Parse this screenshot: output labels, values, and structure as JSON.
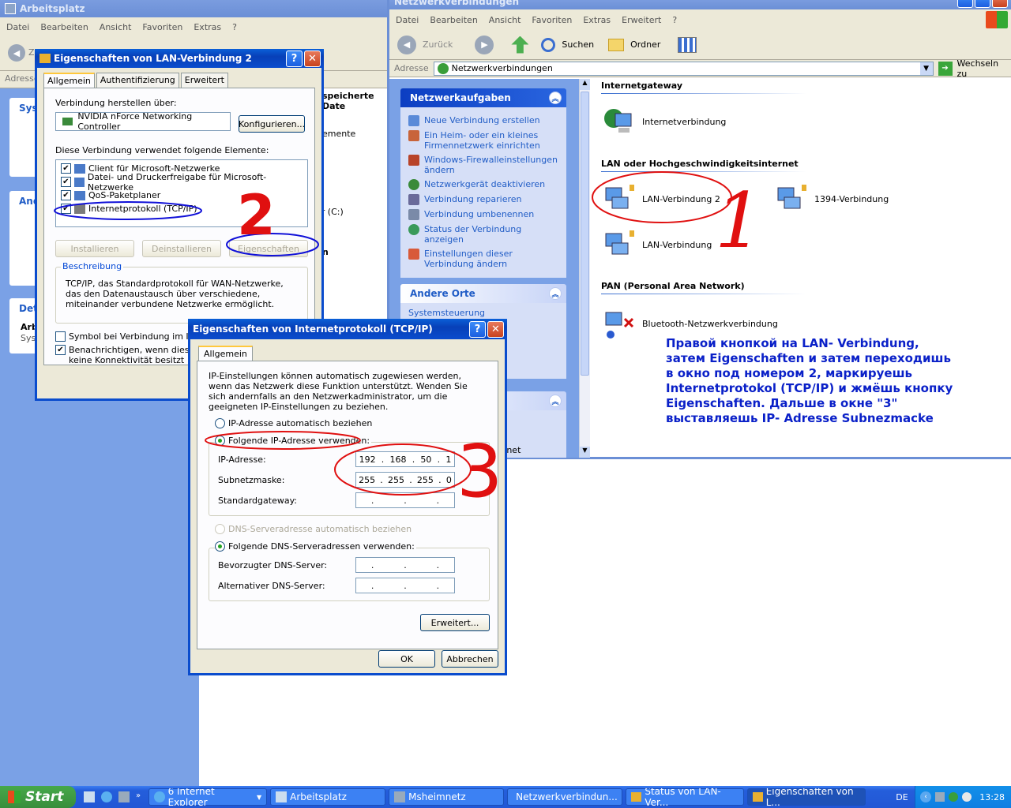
{
  "arbeitsplatz": {
    "title": "Arbeitsplatz",
    "menu": [
      "Datei",
      "Bearbeiten",
      "Ansicht",
      "Favoriten",
      "Extras",
      "?"
    ],
    "address_label": "Adresse",
    "back_label": "Z",
    "side_labels": [
      "Sys",
      "And",
      "Det",
      "Arb",
      "Sys"
    ],
    "frag_1": "speicherte Date",
    "frag_2": "emente",
    "frag_3": "er (C:)",
    "frag_4": "n"
  },
  "netz": {
    "title": "Netzwerkverbindungen",
    "menu": [
      "Datei",
      "Bearbeiten",
      "Ansicht",
      "Favoriten",
      "Extras",
      "Erweitert",
      "?"
    ],
    "back": "Zurück",
    "search": "Suchen",
    "folders": "Ordner",
    "address_label": "Adresse",
    "address_value": "Netzwerkverbindungen",
    "go": "Wechseln zu",
    "panel1_title": "Netzwerkaufgaben",
    "tasks": [
      "Neue Verbindung erstellen",
      "Ein Heim- oder ein kleines Firmennetzwerk einrichten",
      "Windows-Firewalleinstellungen ändern",
      "Netzwerkgerät deaktivieren",
      "Verbindung reparieren",
      "Verbindung umbenennen",
      "Status der Verbindung anzeigen",
      "Einstellungen dieser Verbindung ändern"
    ],
    "panel2_title": "Andere Orte",
    "panel2_frag": "Systemsteuerung",
    "panel3_frag": "rnet",
    "groups": {
      "g1": "Internetgateway",
      "g2": "LAN oder Hochgeschwindigkeitsinternet",
      "g3": "PAN (Personal Area Network)"
    },
    "items": {
      "inet": "Internetverbindung",
      "lan2": "LAN-Verbindung 2",
      "ieee": "1394-Verbindung",
      "lan": "LAN-Verbindung",
      "bt": "Bluetooth-Netzwerkverbindung"
    }
  },
  "lan_dlg": {
    "title": "Eigenschaften von LAN-Verbindung 2",
    "tabs": [
      "Allgemein",
      "Authentifizierung",
      "Erweitert"
    ],
    "connect_via": "Verbindung herstellen über:",
    "adapter": "NVIDIA nForce Networking Controller",
    "configure": "Konfigurieren...",
    "uses": "Diese Verbindung verwendet folgende Elemente:",
    "components": [
      "Client für Microsoft-Netzwerke",
      "Datei- und Druckerfreigabe für Microsoft-Netzwerke",
      "QoS-Paketplaner",
      "Internetprotokoll (TCP/IP)"
    ],
    "install": "Installieren",
    "uninstall": "Deinstallieren",
    "properties": "Eigenschaften",
    "desc_title": "Beschreibung",
    "desc": "TCP/IP, das Standardprotokoll für WAN-Netzwerke, das den Datenaustausch über verschiedene, miteinander verbundene Netzwerke ermöglicht.",
    "show_icon": "Symbol bei Verbindung im Infobe",
    "notify": "Benachrichtigen, wenn diese Ve",
    "notify2": "keine Konnektivität besitzt"
  },
  "tcp_dlg": {
    "title": "Eigenschaften von Internetprotokoll (TCP/IP)",
    "tab": "Allgemein",
    "intro": "IP-Einstellungen können automatisch zugewiesen werden, wenn das Netzwerk diese Funktion unterstützt. Wenden Sie sich andernfalls an den Netzwerkadministrator, um die geeigneten IP-Einstellungen zu beziehen.",
    "auto_ip": "IP-Adresse automatisch beziehen",
    "manual_ip": "Folgende IP-Adresse verwenden:",
    "ip_label": "IP-Adresse:",
    "ip": [
      "192",
      "168",
      "50",
      "1"
    ],
    "mask_label": "Subnetzmaske:",
    "mask": [
      "255",
      "255",
      "255",
      "0"
    ],
    "gw_label": "Standardgateway:",
    "auto_dns": "DNS-Serveradresse automatisch beziehen",
    "manual_dns": "Folgende DNS-Serveradressen verwenden:",
    "dns1": "Bevorzugter DNS-Server:",
    "dns2": "Alternativer DNS-Server:",
    "advanced": "Erweitert...",
    "ok": "OK",
    "cancel": "Abbrechen"
  },
  "annotation": {
    "num1": "1",
    "num2": "2",
    "num3": "3",
    "text": [
      "Правой кнопкой на LAN- Verbindung,",
      "затем Eigenschaften и затем переходишь",
      "в окно под номером 2, маркируешь",
      "Internetprotokol (TCP/IP) и жмёшь кнопку",
      "Eigenschaften. Дальше в окне \"3\"",
      "выставляешь IP- Adresse Subnezmacke"
    ],
    "color": "#0a20c8",
    "mark_red": "#e01010",
    "mark_blue": "#1010d8"
  },
  "taskbar": {
    "start": "Start",
    "items": [
      "6 Internet Explorer",
      "Arbeitsplatz",
      "Msheimnetz",
      "Netzwerkverbindun...",
      "Status von LAN-Ver...",
      "Eigenschaften von L..."
    ],
    "lang": "DE",
    "clock": "13:28"
  }
}
